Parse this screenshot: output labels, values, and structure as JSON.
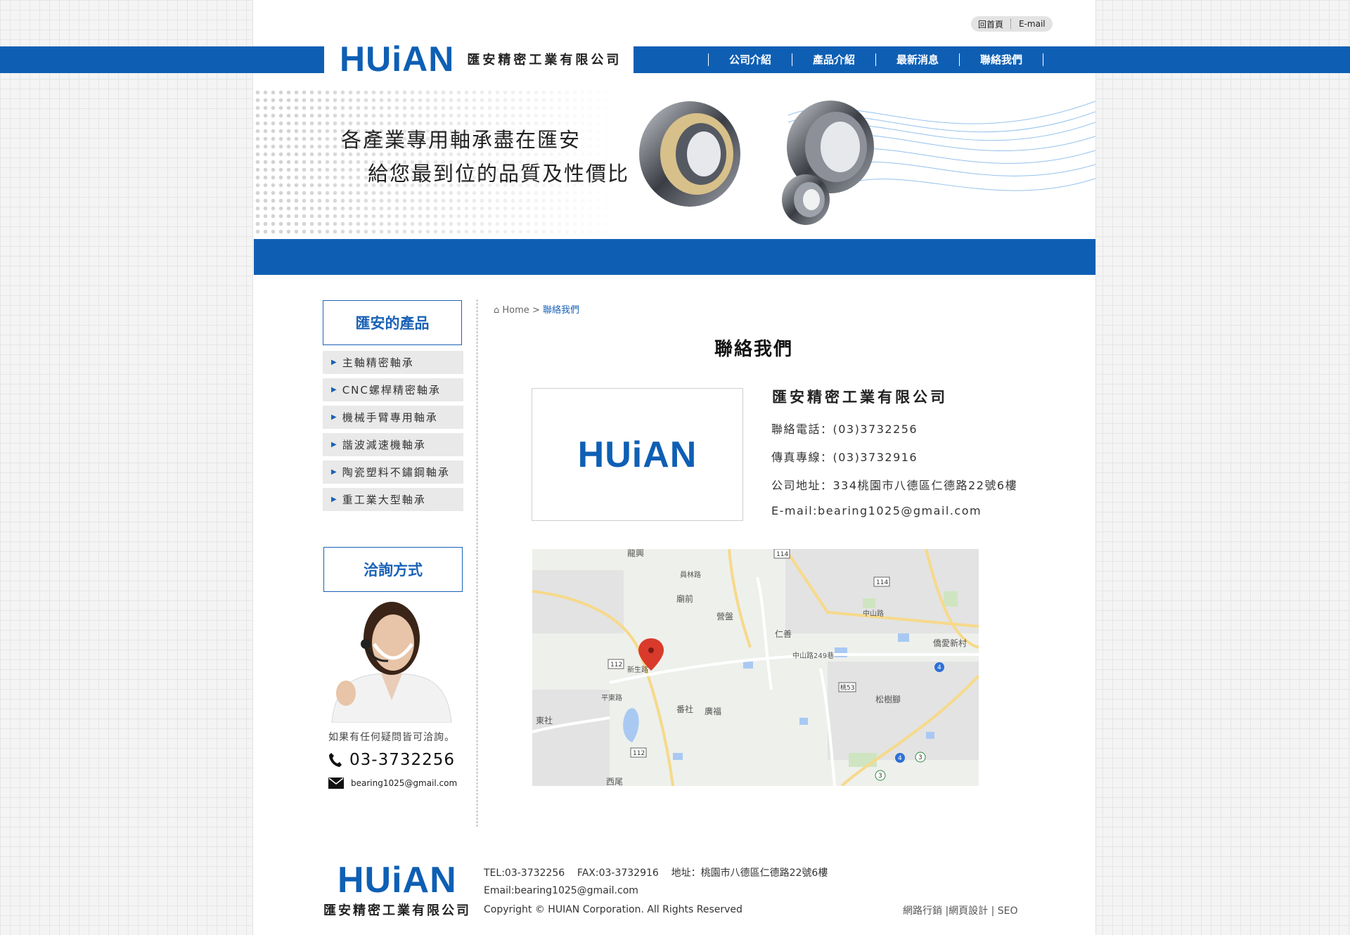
{
  "brand": {
    "logo_text": "HUiAN",
    "company_name": "匯安精密工業有限公司",
    "accent_color": "#0e5fb4"
  },
  "top_links": [
    "回首頁",
    "E-mail"
  ],
  "nav": [
    "公司介紹",
    "產品介紹",
    "最新消息",
    "聯絡我們"
  ],
  "banner": {
    "slogan_line1": "各產業專用軸承盡在匯安",
    "slogan_line2": "給您最到位的品質及性價比"
  },
  "sidebar": {
    "products_title": "匯安的產品",
    "products": [
      "主軸精密軸承",
      "CNC螺桿精密軸承",
      "機械手臂專用軸承",
      "諧波減速機軸承",
      "陶瓷塑料不鏽鋼軸承",
      "重工業大型軸承"
    ],
    "contact_title": "洽詢方式",
    "ask_text": "如果有任何疑問皆可洽詢。",
    "phone": "03-3732256",
    "email": "bearing1025@gmail.com",
    "icons": [
      "phone-icon",
      "envelope-icon"
    ]
  },
  "breadcrumb": {
    "home": "Home",
    "separator": ">",
    "current": "聯絡我們"
  },
  "main": {
    "title": "聯絡我們",
    "card_logo": "HUiAN",
    "company_name": "匯安精密工業有限公司",
    "phone": "聯絡電話：(03)3732256",
    "fax": "傳真專線：(03)3732916",
    "address": "公司地址：334桃園市八德區仁德路22號6樓",
    "email": "E-mail:bearing1025@gmail.com"
  },
  "map": {
    "labels": [
      "廟前",
      "仁善",
      "營盤",
      "番社",
      "廣福",
      "松樹腳",
      "僑愛新村",
      "東社",
      "西尾",
      "中山路249巷",
      "龍興",
      "新生路",
      "平東路",
      "中山路",
      "員林路"
    ],
    "route_numbers": [
      "114",
      "114",
      "112",
      "112",
      "桃53",
      "4",
      "4",
      "3",
      "3"
    ]
  },
  "footer": {
    "logo_text": "HUiAN",
    "company_name": "匯安精密工業有限公司",
    "line1": "TEL:03-3732256    FAX:03-3732916    地址：桃園市八德區仁德路22號6樓",
    "line2": "Email:bearing1025@gmail.com",
    "line3": "Copyright © HUIAN Corporation. All Rights Reserved",
    "links": "網路行銷 |網頁設計 | SEO"
  }
}
